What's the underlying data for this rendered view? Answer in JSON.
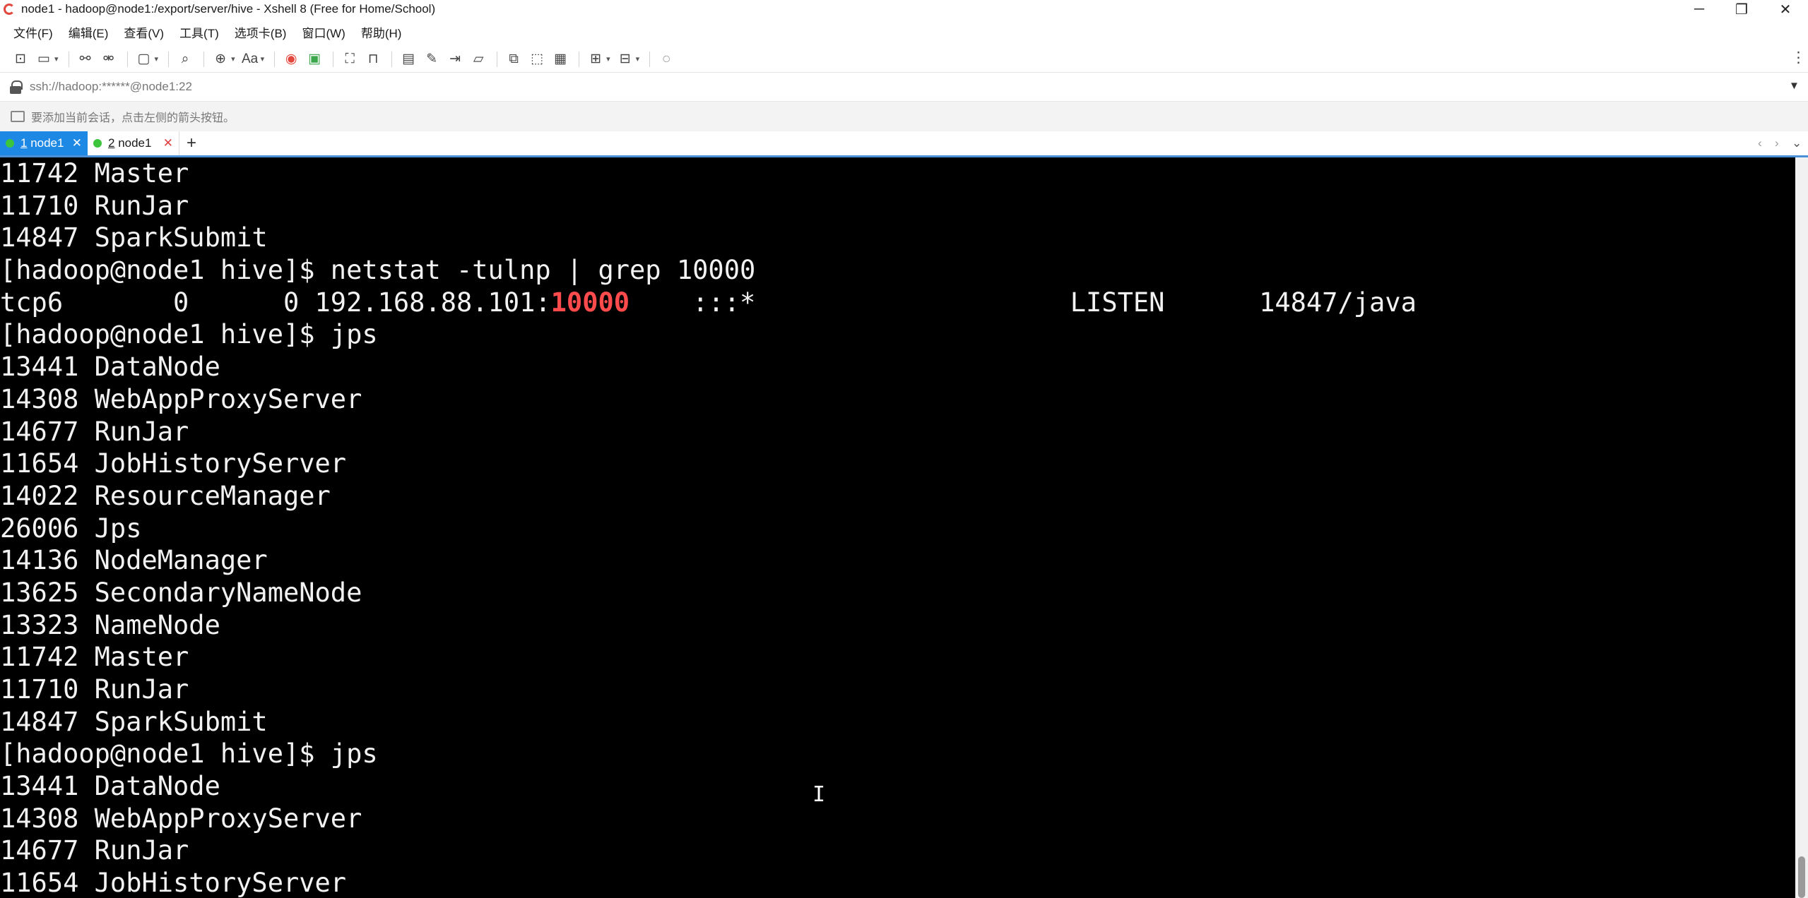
{
  "window": {
    "title": "node1 - hadoop@node1:/export/server/hive - Xshell 8 (Free for Home/School)"
  },
  "window_controls": {
    "minimize": "─",
    "maximize": "❐",
    "close": "✕"
  },
  "menu": [
    {
      "label": "文件(F)"
    },
    {
      "label": "编辑(E)"
    },
    {
      "label": "查看(V)"
    },
    {
      "label": "工具(T)"
    },
    {
      "label": "选项卡(B)"
    },
    {
      "label": "窗口(W)"
    },
    {
      "label": "帮助(H)"
    }
  ],
  "toolbar_icons": {
    "new_session": "⊡",
    "open": "▭",
    "connect": "⚯",
    "disconnect": "⚮",
    "new_window": "▢",
    "find": "⌕",
    "globe": "⊕",
    "font": "Aa",
    "xftp": "◉",
    "xshell": "▣",
    "fullscreen": "⛶",
    "lock": "⊓",
    "compose": "▤",
    "highlight": "✎",
    "script": "⇥",
    "edit": "▱",
    "tunnel": "⧉",
    "log": "⬚",
    "transfer": "▦",
    "new_tab": "⊞",
    "layout": "⊟",
    "chat": "◌",
    "more": "⋮"
  },
  "address": {
    "value": "ssh://hadoop:******@node1:22",
    "dropdown_glyph": "▼"
  },
  "hint": {
    "text": "要添加当前会话，点击左侧的箭头按钮。"
  },
  "tabs": [
    {
      "number": "1",
      "name": " node1",
      "close": "✕",
      "status_color": "#3cc53c"
    },
    {
      "number": "2",
      "name": " node1",
      "close": "✕",
      "status_color": "#3cc53c"
    }
  ],
  "tab_controls": {
    "add": "+",
    "prev": "‹",
    "next": "›",
    "list": "⌄"
  },
  "colors": {
    "accent": "#1e88e5",
    "terminal_bg": "#000000",
    "terminal_fg": "#f2f2f2",
    "highlight": "#ff4b4b"
  },
  "terminal": {
    "lines": [
      {
        "text": "11742 Master"
      },
      {
        "text": "11710 RunJar"
      },
      {
        "text": "14847 SparkSubmit"
      },
      {
        "text": "[hadoop@node1 hive]$ netstat -tulnp | grep 10000"
      },
      {
        "before": "tcp6       0      0 192.168.88.101:",
        "highlight": "10000",
        "after": "    :::*                    LISTEN      14847/java"
      },
      {
        "text": "[hadoop@node1 hive]$ jps"
      },
      {
        "text": "13441 DataNode"
      },
      {
        "text": "14308 WebAppProxyServer"
      },
      {
        "text": "14677 RunJar"
      },
      {
        "text": "11654 JobHistoryServer"
      },
      {
        "text": "14022 ResourceManager"
      },
      {
        "text": "26006 Jps"
      },
      {
        "text": "14136 NodeManager"
      },
      {
        "text": "13625 SecondaryNameNode"
      },
      {
        "text": "13323 NameNode"
      },
      {
        "text": "11742 Master"
      },
      {
        "text": "11710 RunJar"
      },
      {
        "text": "14847 SparkSubmit"
      },
      {
        "text": "[hadoop@node1 hive]$ jps"
      },
      {
        "text": "13441 DataNode"
      },
      {
        "text": "14308 WebAppProxyServer"
      },
      {
        "text": "14677 RunJar"
      },
      {
        "text": "11654 JobHistoryServer"
      }
    ],
    "cursor_glyph": "I"
  }
}
